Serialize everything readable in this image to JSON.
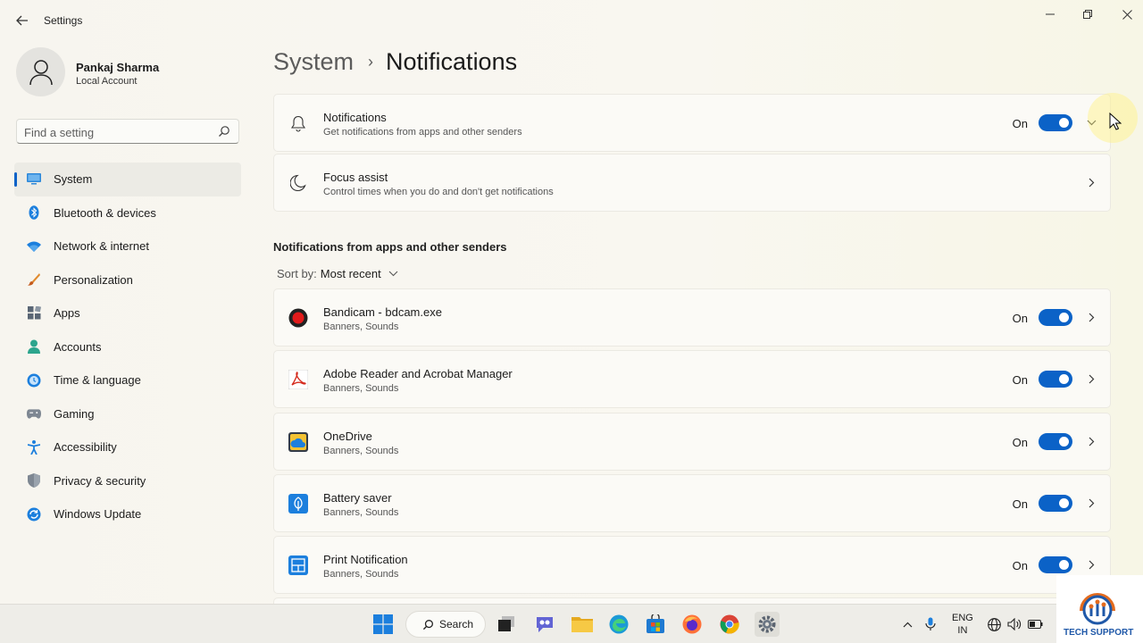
{
  "window": {
    "title": "Settings",
    "controls": {
      "minimize": "—",
      "maximize": "❐",
      "close": "✕"
    }
  },
  "profile": {
    "name": "Pankaj Sharma",
    "account_type": "Local Account"
  },
  "search": {
    "placeholder": "Find a setting"
  },
  "sidebar": {
    "items": [
      {
        "label": "System",
        "icon": "monitor-icon",
        "active": true
      },
      {
        "label": "Bluetooth & devices",
        "icon": "bluetooth-icon"
      },
      {
        "label": "Network & internet",
        "icon": "wifi-icon"
      },
      {
        "label": "Personalization",
        "icon": "brush-icon"
      },
      {
        "label": "Apps",
        "icon": "apps-icon"
      },
      {
        "label": "Accounts",
        "icon": "person-icon"
      },
      {
        "label": "Time & language",
        "icon": "globe-clock-icon"
      },
      {
        "label": "Gaming",
        "icon": "gamepad-icon"
      },
      {
        "label": "Accessibility",
        "icon": "accessibility-icon"
      },
      {
        "label": "Privacy & security",
        "icon": "shield-icon"
      },
      {
        "label": "Windows Update",
        "icon": "update-icon"
      }
    ]
  },
  "breadcrumb": {
    "parent": "System",
    "separator": "›",
    "current": "Notifications"
  },
  "top_cards": [
    {
      "title": "Notifications",
      "subtitle": "Get notifications from apps and other senders",
      "state": "On",
      "icon": "bell-icon"
    },
    {
      "title": "Focus assist",
      "subtitle": "Control times when you do and don't get notifications",
      "icon": "moon-icon"
    }
  ],
  "apps_section": {
    "title": "Notifications from apps and other senders",
    "sort_label": "Sort by:",
    "sort_value": "Most recent",
    "apps": [
      {
        "name": "Bandicam - bdcam.exe",
        "detail": "Banners, Sounds",
        "state": "On",
        "icon": "bandicam-icon"
      },
      {
        "name": "Adobe Reader and Acrobat Manager",
        "detail": "Banners, Sounds",
        "state": "On",
        "icon": "adobe-icon"
      },
      {
        "name": "OneDrive",
        "detail": "Banners, Sounds",
        "state": "On",
        "icon": "onedrive-icon"
      },
      {
        "name": "Battery saver",
        "detail": "Banners, Sounds",
        "state": "On",
        "icon": "battery-saver-icon"
      },
      {
        "name": "Print Notification",
        "detail": "Banners, Sounds",
        "state": "On",
        "icon": "print-notification-icon"
      }
    ]
  },
  "taskbar": {
    "search_label": "Search",
    "language": {
      "line1": "ENG",
      "line2": "IN"
    }
  },
  "watermark": {
    "text": "TECH SUPPORT"
  },
  "colors": {
    "accent": "#0b62c7",
    "background": "#f6f4ee"
  }
}
